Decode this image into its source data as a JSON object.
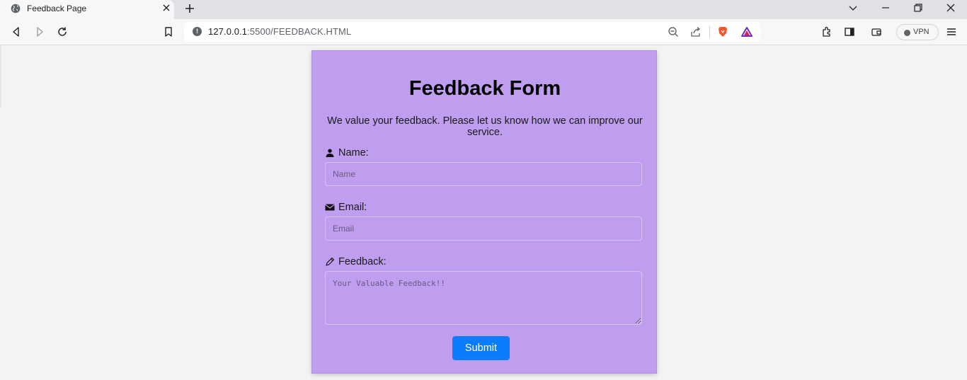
{
  "browser": {
    "tab": {
      "title": "Feedback Page"
    },
    "url": {
      "host": "127.0.0.1",
      "rest": ":5500/FEEDBACK.HTML"
    },
    "vpn_label": "VPN"
  },
  "form": {
    "title": "Feedback Form",
    "intro": "We value your feedback. Please let us know how we can improve our service.",
    "name": {
      "label": "Name:",
      "placeholder": "Name",
      "icon": "person-icon"
    },
    "email": {
      "label": "Email:",
      "placeholder": "Email",
      "icon": "envelope-icon"
    },
    "feedback": {
      "label": "Feedback:",
      "placeholder": "Your Valuable Feedback!!",
      "icon": "pencil-icon"
    },
    "submit_label": "Submit"
  },
  "colors": {
    "card_bg": "#bf9eef",
    "submit_bg": "#0b7dfa",
    "page_bg": "#f3f3f3"
  }
}
